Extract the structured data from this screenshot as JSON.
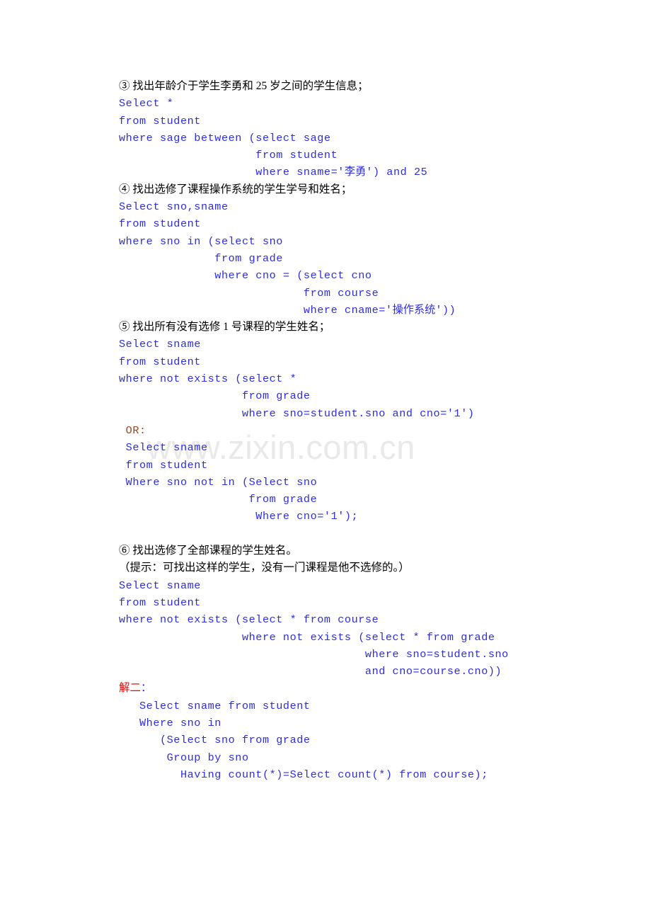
{
  "document": {
    "watermark": "www.zixin.com.cn",
    "blocks": [
      {
        "kind": "heading",
        "name": "question-3-heading",
        "text": "③ 找出年龄介于学生李勇和 25 岁之间的学生信息；"
      },
      {
        "kind": "code",
        "name": "question-3-code",
        "lines": [
          "Select *",
          "from student",
          "where sage between (select sage",
          "                    from student",
          "                    where sname='李勇') and 25"
        ]
      },
      {
        "kind": "heading",
        "name": "question-4-heading",
        "text": "④ 找出选修了课程操作系统的学生学号和姓名；"
      },
      {
        "kind": "code",
        "name": "question-4-code",
        "lines": [
          "Select sno,sname",
          "from student",
          "where sno in (select sno",
          "              from grade",
          "              where cno = (select cno",
          "                           from course",
          "                           where cname='操作系统'))"
        ]
      },
      {
        "kind": "heading",
        "name": "question-5-heading",
        "text": "⑤ 找出所有没有选修 1 号课程的学生姓名；"
      },
      {
        "kind": "code",
        "name": "question-5-code",
        "lines": [
          "Select sname",
          "from student",
          "where not exists (select *",
          "                  from grade",
          "                  where sno=student.sno and cno='1')"
        ]
      },
      {
        "kind": "label-or",
        "name": "or-label",
        "text": " OR:"
      },
      {
        "kind": "code",
        "name": "question-5-alt-code",
        "lines": [
          " Select sname",
          " from student",
          " Where sno not in (Select sno",
          "                   from grade",
          "                    Where cno='1');"
        ]
      },
      {
        "kind": "blank",
        "name": "spacer-line"
      },
      {
        "kind": "heading",
        "name": "question-6-heading",
        "text": "⑥ 找出选修了全部课程的学生姓名。"
      },
      {
        "kind": "heading",
        "name": "question-6-hint",
        "text": "（提示：可找出这样的学生，没有一门课程是他不选修的。）"
      },
      {
        "kind": "code",
        "name": "question-6-code",
        "lines": [
          "Select sname",
          "from student",
          "where not exists (select * from course",
          "                  where not exists (select * from grade",
          "                                    where sno=student.sno",
          "                                    and cno=course.cno))"
        ]
      },
      {
        "kind": "label-jie",
        "name": "solution-two-label",
        "text": "解二",
        "colon": "："
      },
      {
        "kind": "code",
        "name": "question-6-alt-code",
        "lines": [
          "   Select sname from student",
          "   Where sno in",
          "      (Select sno from grade",
          "       Group by sno",
          "         Having count(*)=Select count(*) from course);"
        ]
      }
    ]
  }
}
